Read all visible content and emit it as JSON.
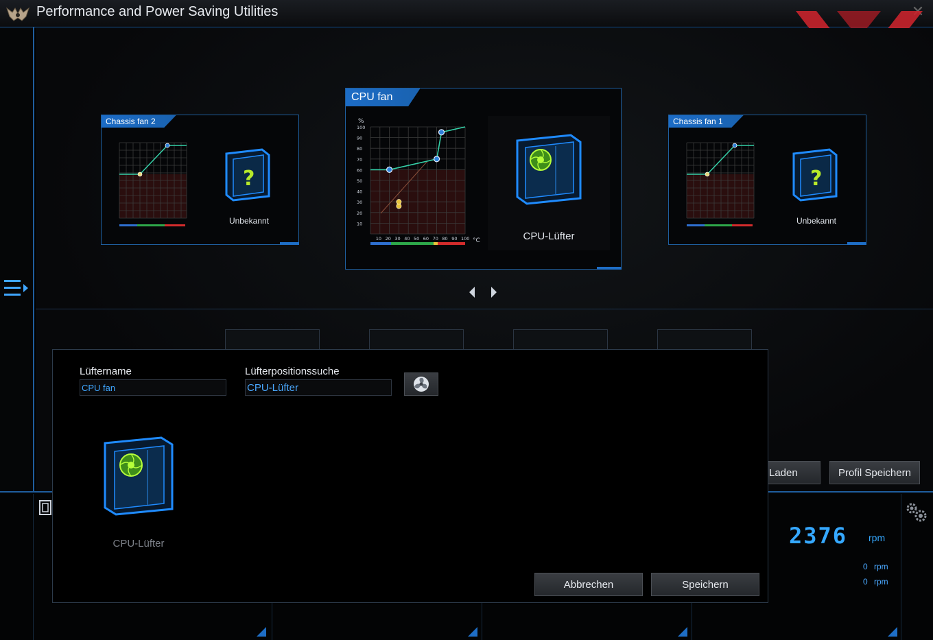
{
  "window": {
    "title": "Performance and Power Saving Utilities",
    "close": "✕"
  },
  "cards": {
    "chassis2": {
      "title": "Chassis fan 2",
      "case_label": "Unbekannt"
    },
    "cpu": {
      "title": "CPU fan",
      "case_label": "CPU-Lüfter"
    },
    "chassis1": {
      "title": "Chassis fan 1",
      "case_label": "Unbekannt"
    }
  },
  "chart_data": {
    "type": "line",
    "title": "",
    "xlabel": "°C",
    "ylabel": "%",
    "xlim": [
      0,
      100
    ],
    "ylim": [
      0,
      100
    ],
    "x_ticks": [
      10,
      20,
      30,
      40,
      50,
      60,
      70,
      80,
      90,
      100
    ],
    "y_ticks": [
      10,
      20,
      30,
      40,
      50,
      60,
      70,
      80,
      90,
      100
    ],
    "series": [
      {
        "x": [
          0,
          20,
          70,
          75,
          100
        ],
        "y": [
          60,
          60,
          70,
          95,
          100
        ]
      }
    ],
    "current": [
      {
        "x": 30,
        "y": 26
      },
      {
        "x": 30,
        "y": 30
      }
    ]
  },
  "dialog": {
    "fan_name_label": "Lüftername",
    "fan_name_value": "CPU fan",
    "position_label": "Lüfterpositionssuche",
    "position_value": "CPU-Lüfter",
    "case_label": "CPU-Lüfter",
    "cancel": "Abbrechen",
    "save": "Speichern"
  },
  "profile": {
    "load": "Laden",
    "save": "Profil Speichern"
  },
  "speeds": {
    "main_value": "2376",
    "main_unit": "rpm",
    "row1_value": "0",
    "row1_unit": "rpm",
    "row2_value": "0",
    "row2_unit": "rpm"
  },
  "colors": {
    "accent": "#1e6ec6",
    "curve": "#35d0a8",
    "rpm": "#35a8ff",
    "warn_fill": "#2a0e0e",
    "brand_red": "#c8232c"
  },
  "icons": {
    "logo": "tuf-eagle-icon",
    "menu": "menu-expand-icon",
    "gear": "gear-icon",
    "fan": "fan-spin-icon"
  }
}
